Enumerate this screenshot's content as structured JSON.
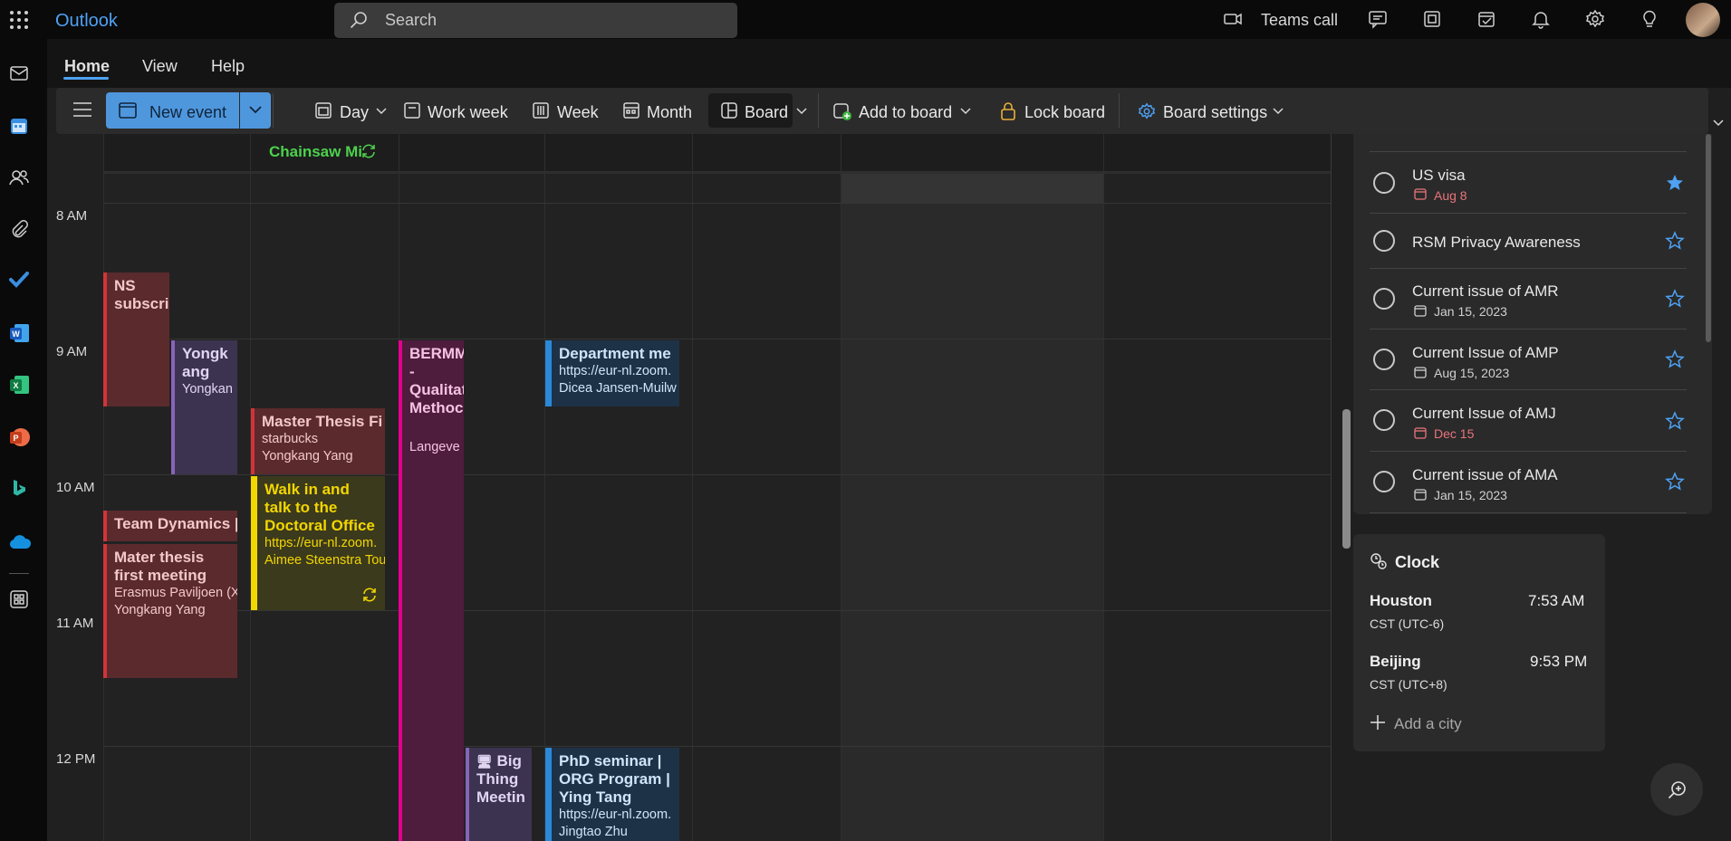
{
  "app": {
    "name": "Outlook"
  },
  "search": {
    "placeholder": "Search"
  },
  "topbar": {
    "teams_call": "Teams call"
  },
  "ribbon": {
    "tabs": [
      "Home",
      "View",
      "Help"
    ],
    "active_tab": "Home"
  },
  "toolbar": {
    "new_event": "New event",
    "day": "Day",
    "work_week": "Work week",
    "week": "Week",
    "month": "Month",
    "board": "Board",
    "add_to_board": "Add to board",
    "lock_board": "Lock board",
    "board_settings": "Board settings"
  },
  "calendar": {
    "allday_event": "Chainsaw Mi",
    "hours": [
      "8 AM",
      "9 AM",
      "10 AM",
      "11 AM",
      "12 PM"
    ],
    "events": [
      {
        "title": "NS subscri",
        "color": "#d13438"
      },
      {
        "title": "Yongk ang",
        "line1": "Yongkan",
        "color": "#8764b8"
      },
      {
        "title": "Master Thesis Fi",
        "line1": "starbucks",
        "line2": "Yongkang Yang",
        "color": "#d13438"
      },
      {
        "title": "Walk in and talk to the Doctoral Office",
        "line1": "https://eur-nl.zoom.",
        "line2": "Aimee Steenstra Tou",
        "color": "#f2d600"
      },
      {
        "title": "Team Dynamics |",
        "color": "#d13438"
      },
      {
        "title": "Mater thesis first meeting",
        "line1": "Erasmus Paviljoen (X",
        "line2": "Yongkang Yang",
        "color": "#d13438"
      },
      {
        "title": "BERMM - Qualitat Methoc",
        "line1": "Langeve",
        "color": "#e3008c"
      },
      {
        "title": "Department me",
        "line1": "https://eur-nl.zoom.",
        "line2": "Dicea Jansen-Muilw",
        "color": "#2b88d8"
      },
      {
        "title": "Big Thing Meetin",
        "color": "#8764b8"
      },
      {
        "title": "PhD seminar | ORG Program | Ying Tang",
        "line1": "https://eur-nl.zoom.",
        "line2": "Jingtao Zhu",
        "color": "#2b88d8"
      }
    ]
  },
  "todo": {
    "partial_top": "...",
    "items": [
      {
        "title": "US visa",
        "date": "Aug 8",
        "overdue": true,
        "starred": true
      },
      {
        "title": "RSM Privacy Awareness",
        "date": "",
        "overdue": false,
        "starred": false
      },
      {
        "title": "Current issue of AMR",
        "date": "Jan 15, 2023",
        "overdue": false,
        "starred": false
      },
      {
        "title": "Current Issue of AMP",
        "date": "Aug 15, 2023",
        "overdue": false,
        "starred": false
      },
      {
        "title": "Current Issue of AMJ",
        "date": "Dec 15",
        "overdue": true,
        "starred": false
      },
      {
        "title": "Current issue of AMA",
        "date": "Jan 15, 2023",
        "overdue": false,
        "starred": false
      }
    ]
  },
  "clock": {
    "title": "Clock",
    "cities": [
      {
        "name": "Houston",
        "time": "7:53 AM",
        "tz": "CST (UTC-6)"
      },
      {
        "name": "Beijing",
        "time": "9:53 PM",
        "tz": "CST (UTC+8)"
      }
    ],
    "add_city": "Add a city"
  },
  "colors": {
    "accent": "#4f97dd",
    "overdue": "#e9747b",
    "star": "#4ea1f3",
    "allday": "#4cd14c"
  }
}
